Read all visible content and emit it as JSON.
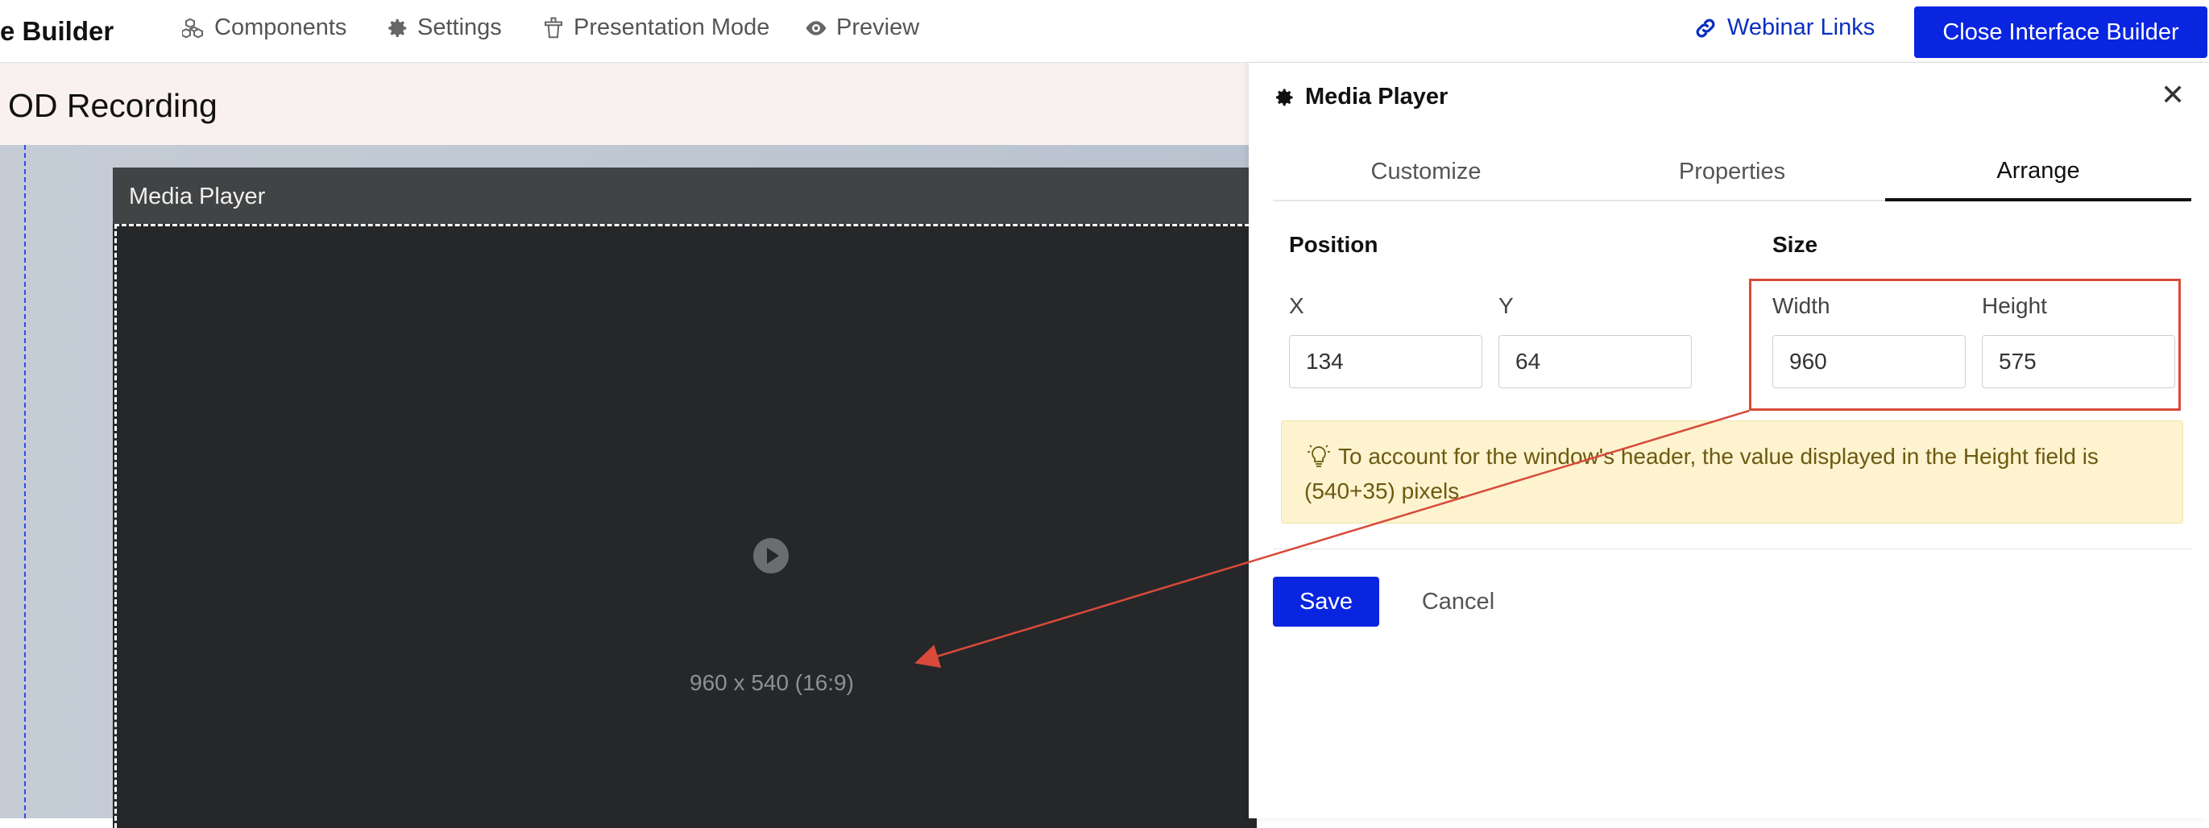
{
  "topbar": {
    "app_title": "e Builder",
    "nav": [
      {
        "label": "Components",
        "icon": "cubes-icon"
      },
      {
        "label": "Settings",
        "icon": "gear-icon"
      },
      {
        "label": "Presentation Mode",
        "icon": "podium-icon"
      },
      {
        "label": "Preview",
        "icon": "eye-icon"
      }
    ],
    "webinar_links": "Webinar Links",
    "close_builder": "Close Interface Builder"
  },
  "page": {
    "title": "OD Recording"
  },
  "canvas": {
    "media_player": {
      "header": "Media Player",
      "dimensions": "960 x 540 (16:9)"
    }
  },
  "panel": {
    "title": "Media Player",
    "tabs": [
      "Customize",
      "Properties",
      "Arrange"
    ],
    "active_tab": "Arrange",
    "position": {
      "label": "Position",
      "x_label": "X",
      "x_value": "134",
      "y_label": "Y",
      "y_value": "64"
    },
    "size": {
      "label": "Size",
      "width_label": "Width",
      "width_value": "960",
      "height_label": "Height",
      "height_value": "575"
    },
    "hint": "To account for the window's header, the value displayed in the Height field is (540+35) pixels.",
    "save": "Save",
    "cancel": "Cancel"
  },
  "colors": {
    "primary": "#0a25e0",
    "link": "#0a2fbf",
    "annotation": "#d94a3a",
    "hint_bg": "#fdf3cf"
  }
}
